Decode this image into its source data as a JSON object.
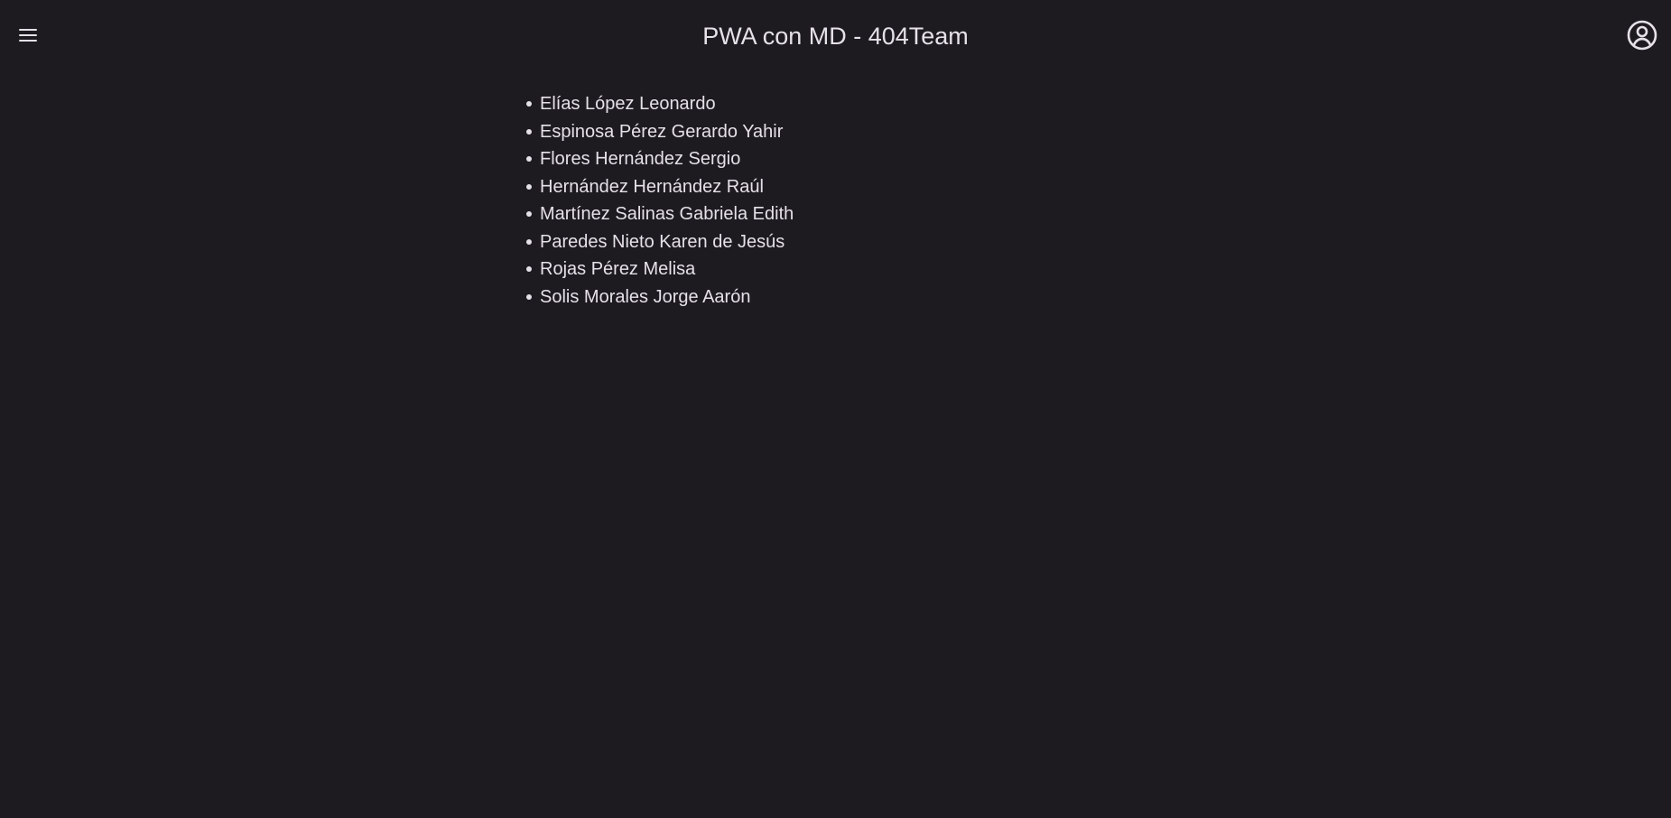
{
  "header": {
    "title": "PWA con MD - 404Team",
    "left_icon": "menu-icon",
    "right_icon": "account-circle-icon"
  },
  "team": {
    "members": [
      "Elías López Leonardo",
      "Espinosa Pérez Gerardo Yahir",
      "Flores Hernández Sergio",
      "Hernández Hernández Raúl",
      "Martínez Salinas Gabriela Edith",
      "Paredes Nieto Karen de Jesús",
      "Rojas Pérez Melisa",
      "Solis Morales Jorge Aarón"
    ]
  },
  "colors": {
    "background": "#1d1b20",
    "text": "#e6e0e9"
  }
}
